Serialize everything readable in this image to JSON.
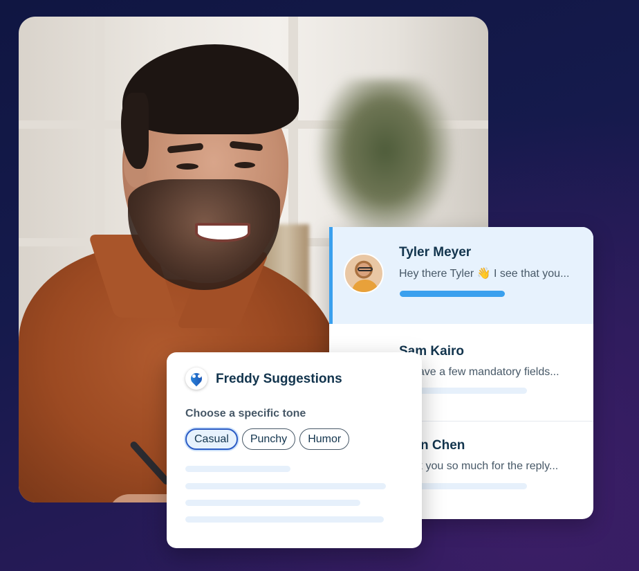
{
  "conversations": [
    {
      "name": "Tyler Meyer",
      "preview": "Hey there Tyler 👋 I see that you...",
      "active": true
    },
    {
      "name": "Sam Kairo",
      "preview": "have a few mandatory fields...",
      "active": false
    },
    {
      "name": "n Chen",
      "preview": "k you so much for the reply...",
      "active": false
    }
  ],
  "freddy": {
    "title": "Freddy Suggestions",
    "tone_label": "Choose a specific tone",
    "tones": [
      {
        "label": "Casual",
        "selected": true
      },
      {
        "label": "Punchy",
        "selected": false
      },
      {
        "label": "Humor",
        "selected": false
      }
    ]
  },
  "colors": {
    "accent": "#3aa0ee",
    "active_row_bg": "#e7f2fd",
    "selected_chip_border": "#2c5cc5",
    "text_dark": "#12344d"
  },
  "icons": {
    "freddy": "freddy-ai-icon",
    "avatar": "user-avatar"
  }
}
